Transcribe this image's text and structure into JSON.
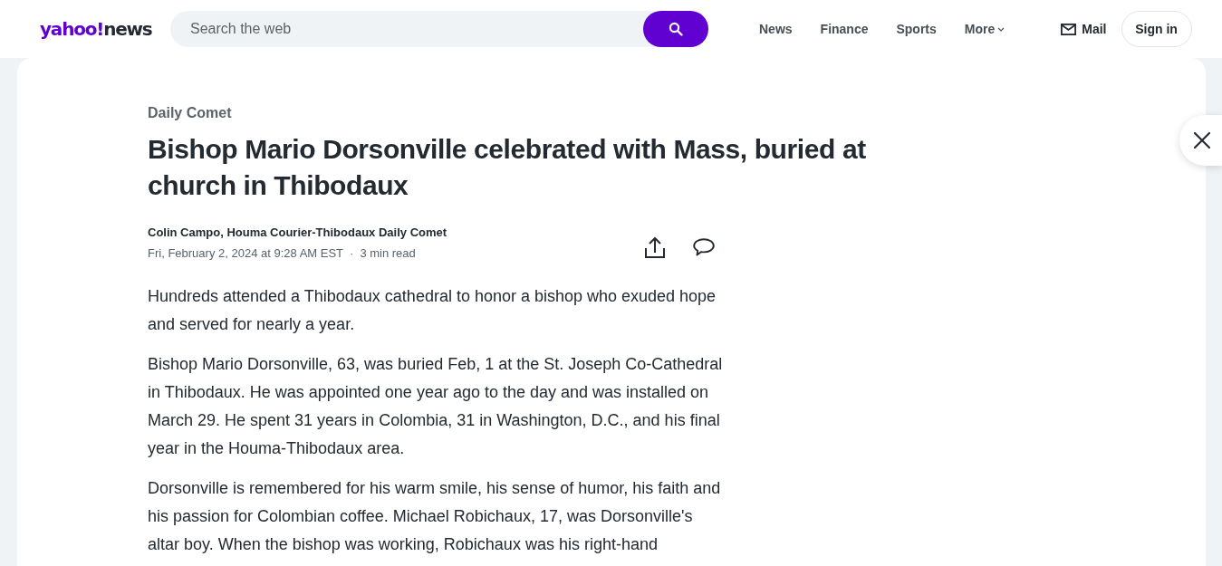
{
  "header": {
    "logo": {
      "brand": "yahoo!",
      "section": "news"
    },
    "search": {
      "placeholder": "Search the web"
    },
    "nav": [
      {
        "label": "News",
        "kind": "link"
      },
      {
        "label": "Finance",
        "kind": "link"
      },
      {
        "label": "Sports",
        "kind": "link"
      },
      {
        "label": "More",
        "kind": "menu"
      }
    ],
    "mail": {
      "label": "Mail"
    },
    "sign_in": {
      "label": "Sign in"
    }
  },
  "article": {
    "source": "Daily Comet",
    "title": "Bishop Mario Dorsonville celebrated with Mass, buried at church in Thibodaux",
    "byline": "Colin Campo, Houma Courier-Thibodaux Daily Comet",
    "date": "Fri, February 2, 2024 at 9:28 AM EST",
    "separator": "·",
    "read_time": "3 min read",
    "paragraphs": [
      "Hundreds attended a Thibodaux cathedral to honor a bishop who exuded hope and served for nearly a year.",
      "Bishop Mario Dorsonville, 63, was buried Feb, 1 at the St. Joseph Co-Cathedral in Thibodaux. He was appointed one year ago to the day and was installed on March 29. He spent 31 years in Colombia, 31 in Washington, D.C., and his final year in the Houma-Thibodaux area.",
      "Dorsonville is remembered for his warm smile, his sense of humor, his faith and his passion for Colombian coffee. Michael Robichaux, 17, was Dorsonville's altar boy. When the bishop was working, Robichaux was his right-hand"
    ]
  }
}
